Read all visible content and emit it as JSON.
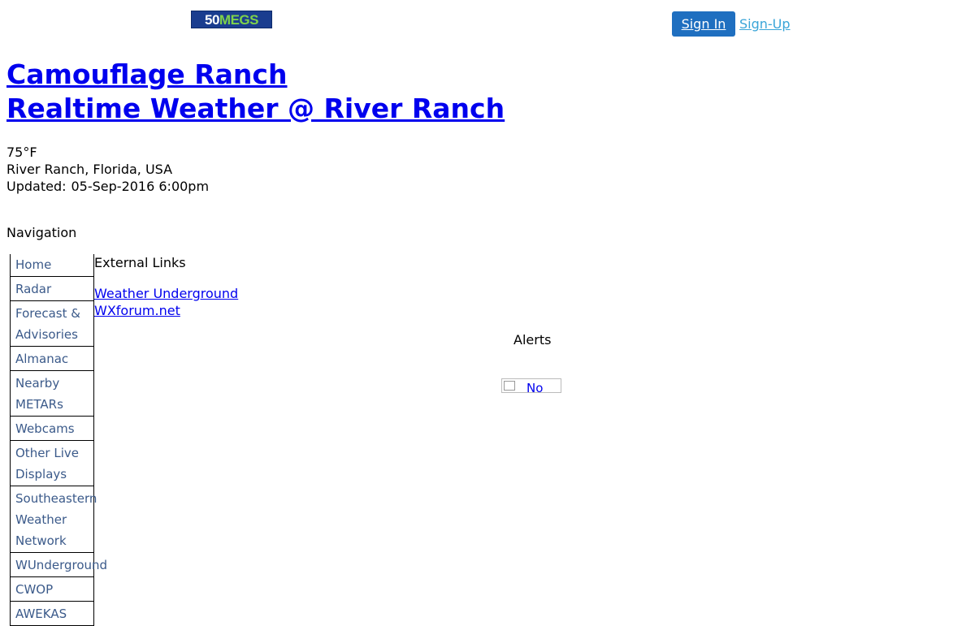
{
  "header": {
    "logo_number": "50",
    "logo_word": "MEGS",
    "sign_in": "Sign In",
    "sign_up": "Sign-Up"
  },
  "title": {
    "line1": "Camouflage Ranch",
    "line2": "Realtime Weather @ River Ranch"
  },
  "conditions": {
    "temperature": "75°F",
    "location": "River Ranch, Florida, USA",
    "updated_label": "Updated:",
    "updated_value": "05-Sep-2016 6:00pm"
  },
  "navigation": {
    "heading": "Navigation",
    "items": [
      {
        "label": "Home"
      },
      {
        "label": "Radar"
      },
      {
        "label": "Forecast & Advisories"
      },
      {
        "label": "Almanac"
      },
      {
        "label": "Nearby METARs"
      },
      {
        "label": "Webcams"
      },
      {
        "label": "Other Live Displays"
      },
      {
        "label": "Southeastern Weather Network"
      },
      {
        "label": "WUnderground"
      },
      {
        "label": "CWOP"
      },
      {
        "label": "AWEKAS"
      }
    ]
  },
  "external_links": {
    "heading": "External Links",
    "links": [
      {
        "label": "Weather Underground"
      },
      {
        "label": "WXforum.net"
      }
    ]
  },
  "alerts": {
    "heading": "Alerts",
    "image_alt": "No"
  },
  "colors": {
    "link": "#0000ee",
    "nav_text": "#3b5a8a",
    "sign_in_bg": "#1f6fc0",
    "sign_up": "#3aa5d8"
  }
}
